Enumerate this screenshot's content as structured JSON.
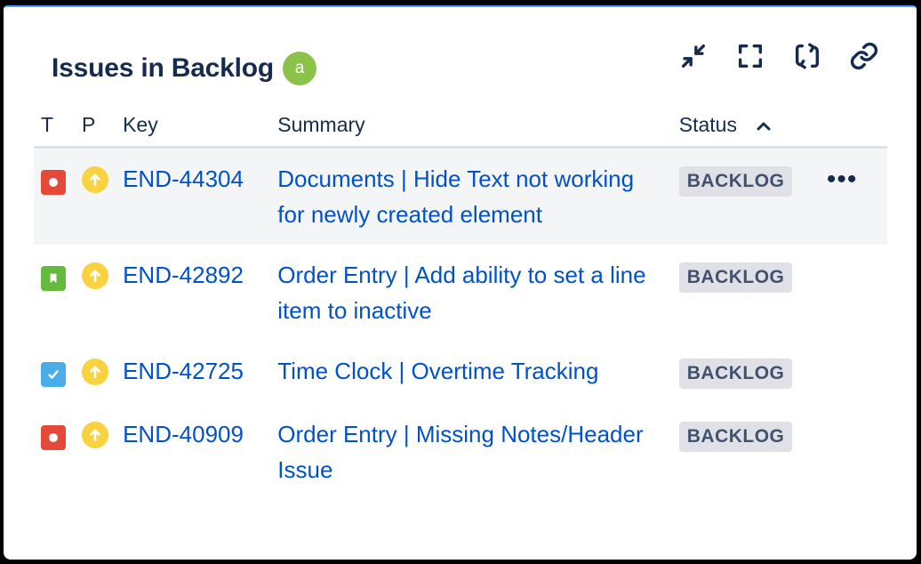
{
  "gadget": {
    "title": "Issues in Backlog",
    "avatar_letter": "a",
    "toolbar": [
      "minimize-icon",
      "maximize-icon",
      "refresh-icon",
      "link-icon"
    ]
  },
  "table": {
    "headers": {
      "type": "T",
      "priority": "P",
      "key": "Key",
      "summary": "Summary",
      "status": "Status"
    },
    "sort": {
      "column": "Status",
      "direction": "ascending"
    },
    "rows": [
      {
        "type": "bug",
        "priority": "major",
        "key": "END-44304",
        "summary": "Documents | Hide Text not working for newly created element",
        "status": "BACKLOG",
        "highlighted": true
      },
      {
        "type": "story",
        "priority": "major",
        "key": "END-42892",
        "summary": "Order Entry | Add ability to set a line item to inactive",
        "status": "BACKLOG",
        "highlighted": false
      },
      {
        "type": "task",
        "priority": "major",
        "key": "END-42725",
        "summary": "Time Clock | Overtime Tracking",
        "status": "BACKLOG",
        "highlighted": false
      },
      {
        "type": "bug",
        "priority": "major",
        "key": "END-40909",
        "summary": "Order Entry | Missing Notes/Header Issue",
        "status": "BACKLOG",
        "highlighted": false
      }
    ],
    "more_actions": "•••"
  },
  "colors": {
    "link": "#0052cc",
    "bug": "#e5493a",
    "story": "#63ba3c",
    "task": "#4bade8",
    "priority": "#f9d23f"
  }
}
